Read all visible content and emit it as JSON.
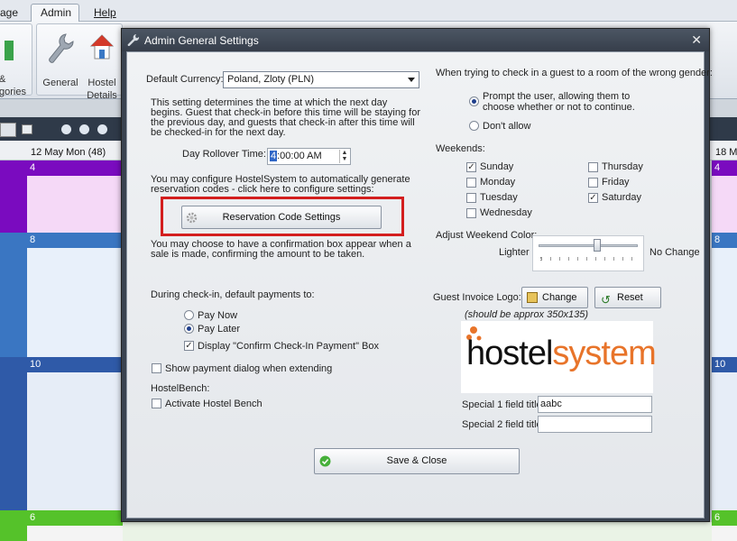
{
  "app": {
    "menu": {
      "left": "age",
      "admin": "Admin",
      "help": "Help"
    },
    "ribbon": {
      "general": "General",
      "hostel_details_1": "Hostel",
      "hostel_details_2": "Details",
      "cut_label_1": "&",
      "cut_label_2": "gories"
    },
    "calendar": {
      "date_header": "12 May Mon (48)",
      "date_header_right": "18 M",
      "band_4": "4",
      "band_8": "8",
      "band_10": "10",
      "band_6": "6",
      "colors": {
        "purple": "#7a0bbf",
        "blue": "#3a76c2",
        "navy": "#2f5aa8",
        "green": "#55c22a"
      }
    }
  },
  "dialog": {
    "title": "Admin General Settings",
    "default_currency_label": "Default Currency:",
    "default_currency_value": "Poland, Zloty (PLN)",
    "rollover_text": "This setting determines the time at which the next day begins. Guest that check-in before this time will be staying for the previous day, and guests that check-in after this time will be checked-in for the next day.",
    "day_rollover_label": "Day Rollover Time:",
    "day_rollover_hour": "4",
    "day_rollover_rest": ":00:00 AM",
    "reservation_text": "You may configure HostelSystem to automatically generate reservation codes - click here to configure settings:",
    "reservation_button": "Reservation Code Settings",
    "confirmation_text": "You may choose to have a confirmation box appear when a sale is made, confirming the amount to be taken.",
    "checkin_payments_label": "During check-in, default payments to:",
    "pay_now": "Pay Now",
    "pay_later": "Pay Later",
    "display_confirm": "Display \"Confirm Check-In Payment\" Box",
    "show_payment_dialog": "Show payment dialog when extending",
    "hostelbench_label": "HostelBench:",
    "activate_hostel_bench": "Activate Hostel Bench",
    "gender_label": "When trying to check in a guest to a room of the wrong gender:",
    "prompt_user_1": "Prompt the user, allowing them to",
    "prompt_user_2": "choose whether or not to continue.",
    "dont_allow": "Don't allow",
    "weekends_label": "Weekends:",
    "days": {
      "sunday": "Sunday",
      "monday": "Monday",
      "tuesday": "Tuesday",
      "wednesday": "Wednesday",
      "thursday": "Thursday",
      "friday": "Friday",
      "saturday": "Saturday"
    },
    "adjust_color_label": "Adjust Weekend Color:",
    "lighter": "Lighter",
    "no_change": "No Change",
    "weekend_color_level": 0.6,
    "invoice_logo_label": "Guest Invoice Logo:",
    "change_button": "Change",
    "reset_button": "Reset",
    "logo_hint": "(should be approx 350x135)",
    "logo_text_1": "hostel",
    "logo_text_2": "system",
    "special1_label": "Special 1 field title:",
    "special1_value": "aabc",
    "special2_label": "Special 2 field title:",
    "special2_value": "",
    "save_close": "Save & Close",
    "highlight_color": "#d31e1e"
  }
}
